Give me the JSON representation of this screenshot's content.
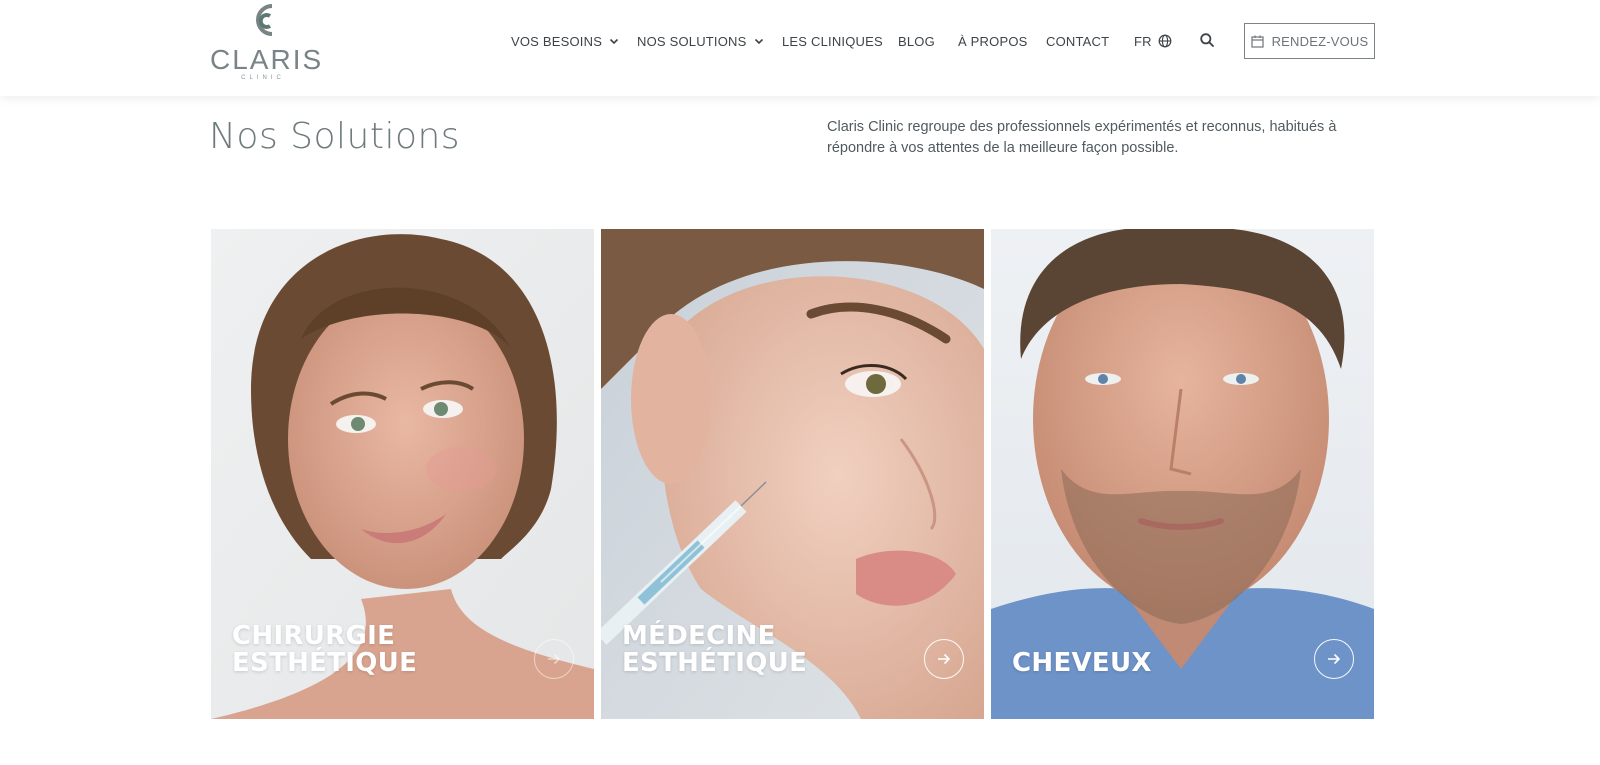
{
  "brand": {
    "name": "CLARIS",
    "sub": "CLINIC"
  },
  "nav": {
    "items": [
      {
        "label": "VOS BESOINS",
        "dropdown": true
      },
      {
        "label": "NOS SOLUTIONS",
        "dropdown": true
      },
      {
        "label": "LES CLINIQUES",
        "dropdown": false
      },
      {
        "label": "BLOG",
        "dropdown": false
      },
      {
        "label": "À PROPOS",
        "dropdown": false
      },
      {
        "label": "CONTACT",
        "dropdown": false
      }
    ],
    "language": "FR",
    "language_icon": "globe-icon",
    "search_icon": "search-icon",
    "cta_label": "RENDEZ-VOUS",
    "cta_icon": "calendar-icon"
  },
  "page": {
    "title": "Nos Solutions",
    "intro": "Claris Clinic regroupe des professionnels expérimentés et reconnus, habitués à répondre à vos attentes de la meilleure façon possible."
  },
  "cards": [
    {
      "lines": [
        "CHIRURGIE",
        "ESTHÉTIQUE"
      ],
      "image": "portrait-woman-freckles",
      "arrow_icon": "arrow-right-icon"
    },
    {
      "lines": [
        "MÉDECINE",
        "ESTHÉTIQUE"
      ],
      "image": "profile-woman-syringe",
      "arrow_icon": "arrow-right-icon"
    },
    {
      "lines": [
        "CHEVEUX"
      ],
      "image": "portrait-man-beard",
      "arrow_icon": "arrow-right-icon"
    }
  ],
  "colors": {
    "brand_gray": "#7a8486",
    "text": "#3d4449",
    "accent_green": "#5d7a72"
  }
}
